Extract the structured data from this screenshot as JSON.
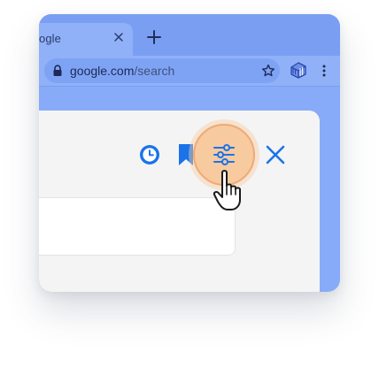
{
  "browser": {
    "tab_title": "ogle",
    "url_host": "google.com",
    "url_path": "/search"
  },
  "toolbar": {
    "icons": [
      "lock-icon",
      "star-icon",
      "extension-icon",
      "more-menu-icon"
    ]
  },
  "panel": {
    "icons": [
      "history-icon",
      "bookmark-icon",
      "sliders-icon",
      "close-icon"
    ]
  },
  "cursor": "hand-pointer-icon",
  "colors": {
    "tabstrip": "#7a9ff2",
    "toolbar": "#90b1f8",
    "accent_blue": "#1a73e8",
    "highlight_fill": "#f7caa0",
    "highlight_border": "#f2a970",
    "panel": "#f4f4f4"
  }
}
